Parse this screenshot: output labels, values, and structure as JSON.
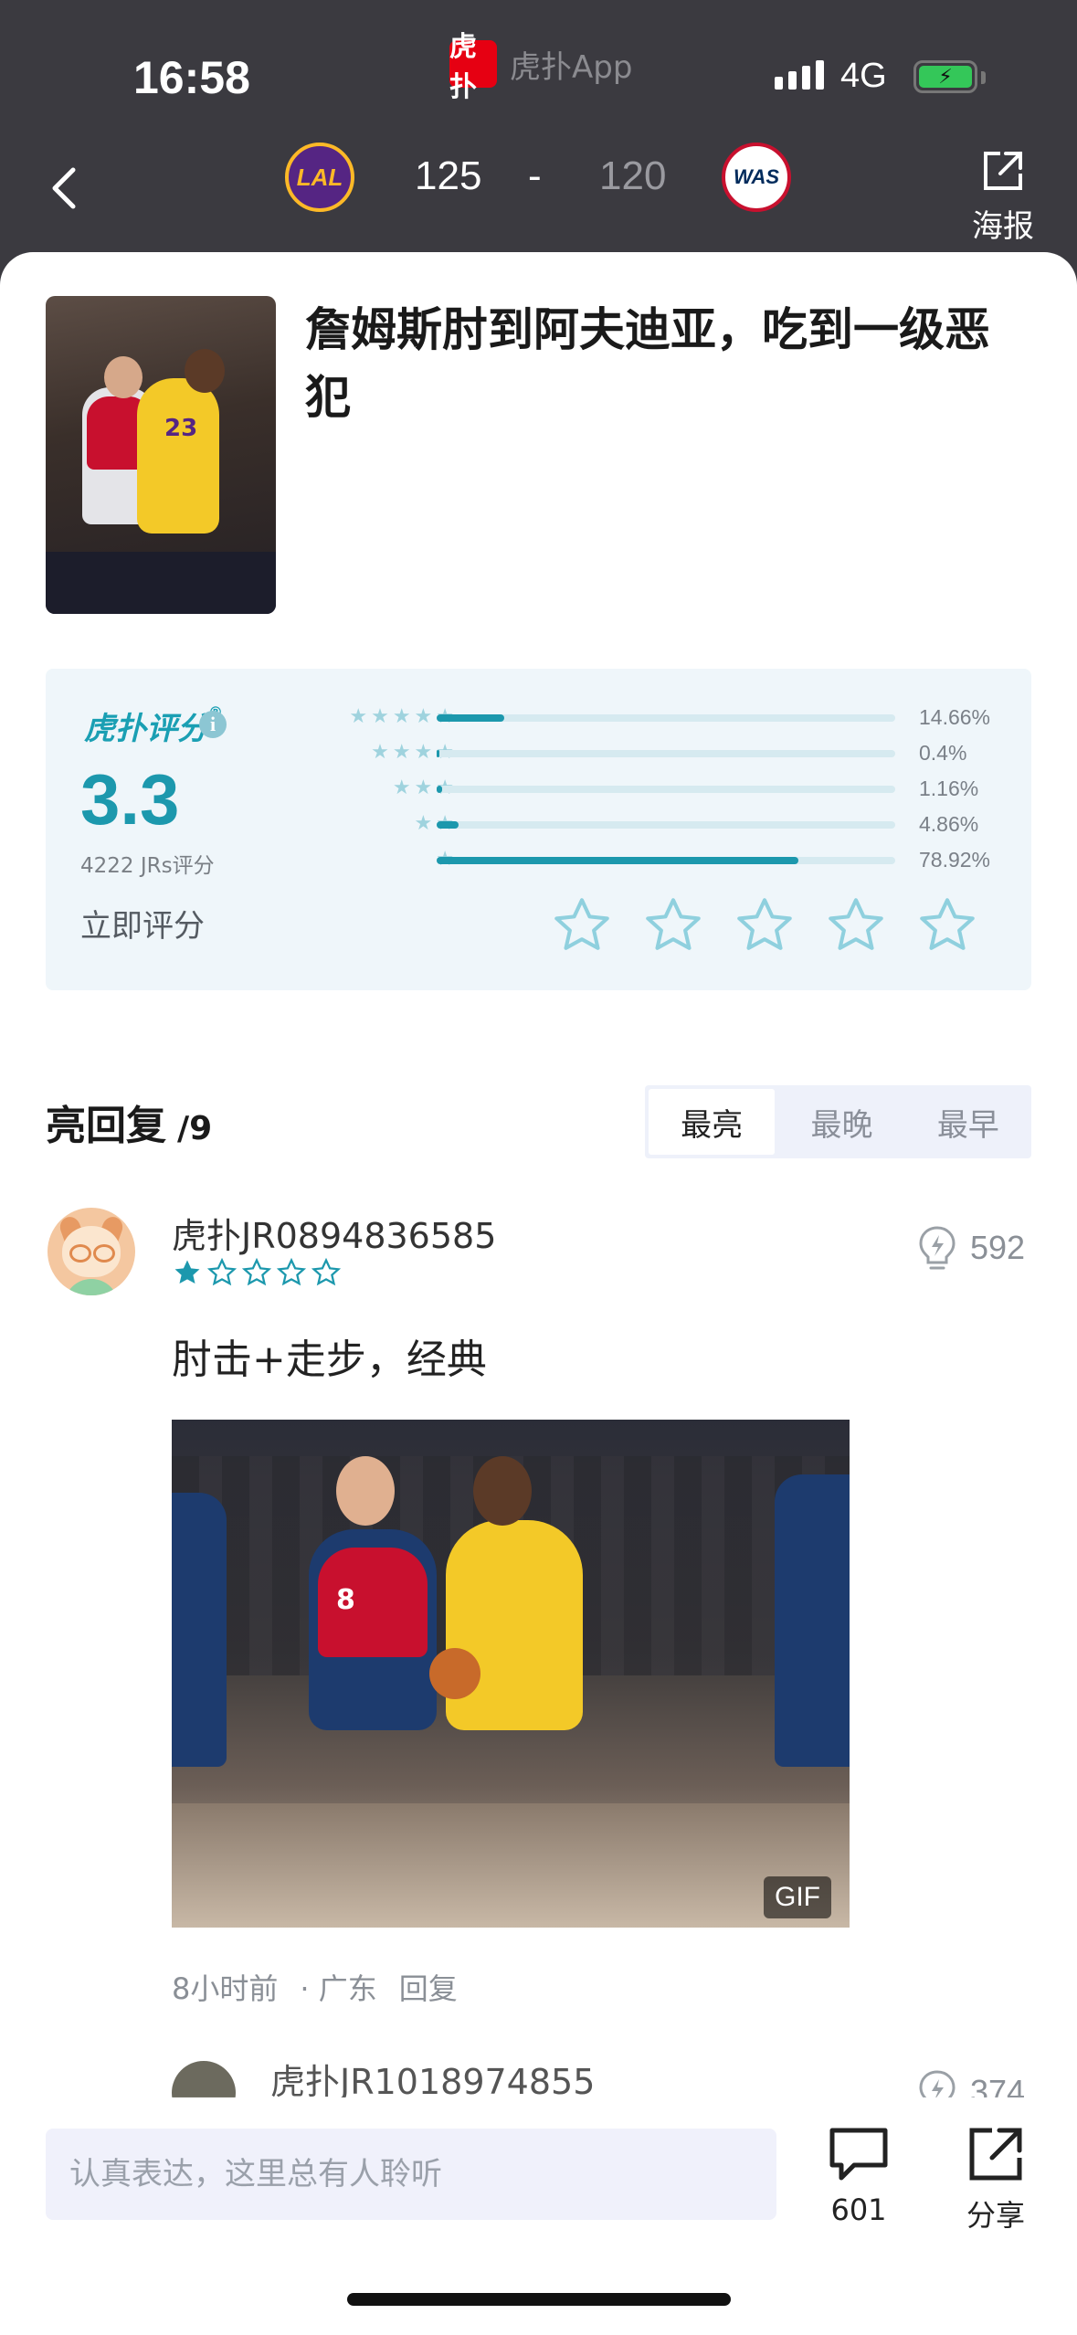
{
  "status_bar": {
    "time": "16:58",
    "app_name": "虎扑App",
    "app_logo_text": "虎扑",
    "network": "4G"
  },
  "game_header": {
    "home_team": "LAL",
    "away_team": "WAS",
    "home_score": "125",
    "dash": "-",
    "away_score": "120",
    "poster_label": "海报"
  },
  "post": {
    "title": "詹姆斯肘到阿夫迪亚，吃到一级恶犯",
    "thumb_jersey_number": "23"
  },
  "rating": {
    "brand": "虎扑评分",
    "brand_mark": "®",
    "info_icon_glyph": "i",
    "score": "3.3",
    "count_text": "4222 JRs评分",
    "rate_now_label": "立即评分",
    "distribution": [
      {
        "stars": 5,
        "percent": 14.66,
        "label": "14.66%"
      },
      {
        "stars": 4,
        "percent": 0.4,
        "label": "0.4%"
      },
      {
        "stars": 3,
        "percent": 1.16,
        "label": "1.16%"
      },
      {
        "stars": 2,
        "percent": 4.86,
        "label": "4.86%"
      },
      {
        "stars": 1,
        "percent": 78.92,
        "label": "78.92%"
      }
    ],
    "accent_color": "#1c98ad"
  },
  "replies": {
    "title": "亮回复",
    "count": "/9",
    "sort_tabs": [
      "最亮",
      "最晚",
      "最早"
    ],
    "active_sort": "最亮"
  },
  "comments": [
    {
      "username": "虎扑JR0894836585",
      "star_rating": 1,
      "likes": "592",
      "text": "肘击+走步，经典",
      "media_badge": "GIF",
      "gif_jersey_number": "8",
      "time": "8小时前",
      "location": "· 广东",
      "reply_label": "回复"
    },
    {
      "username": "虎扑JR1018974855",
      "likes": "374"
    }
  ],
  "bottom_bar": {
    "input_placeholder": "认真表达，这里总有人聆听",
    "comment_count": "601",
    "share_label": "分享"
  }
}
